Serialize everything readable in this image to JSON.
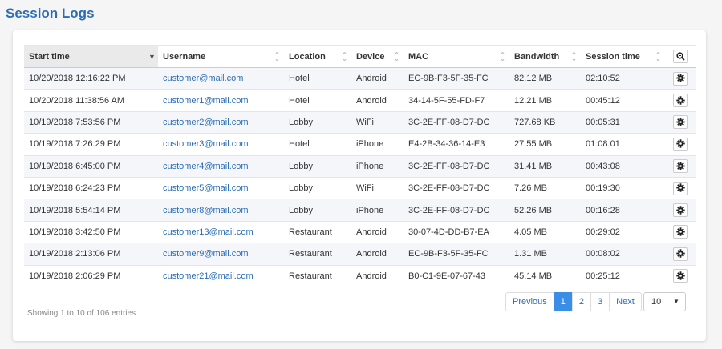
{
  "page": {
    "title": "Session Logs"
  },
  "table": {
    "columns": [
      "Start time",
      "Username",
      "Location",
      "Device",
      "MAC",
      "Bandwidth",
      "Session time"
    ],
    "sorted_column": "Start time",
    "rows": [
      [
        "10/20/2018 12:16:22 PM",
        "customer@mail.com",
        "Hotel",
        "Android",
        "EC-9B-F3-5F-35-FC",
        "82.12 MB",
        "02:10:52"
      ],
      [
        "10/20/2018 11:38:56 AM",
        "customer1@mail.com",
        "Hotel",
        "Android",
        "34-14-5F-55-FD-F7",
        "12.21 MB",
        "00:45:12"
      ],
      [
        "10/19/2018 7:53:56 PM",
        "customer2@mail.com",
        "Lobby",
        "WiFi",
        "3C-2E-FF-08-D7-DC",
        "727.68 KB",
        "00:05:31"
      ],
      [
        "10/19/2018 7:26:29 PM",
        "customer3@mail.com",
        "Hotel",
        "iPhone",
        "E4-2B-34-36-14-E3",
        "27.55 MB",
        "01:08:01"
      ],
      [
        "10/19/2018 6:45:00 PM",
        "customer4@mail.com",
        "Lobby",
        "iPhone",
        "3C-2E-FF-08-D7-DC",
        "31.41 MB",
        "00:43:08"
      ],
      [
        "10/19/2018 6:24:23 PM",
        "customer5@mail.com",
        "Lobby",
        "WiFi",
        "3C-2E-FF-08-D7-DC",
        "7.26 MB",
        "00:19:30"
      ],
      [
        "10/19/2018 5:54:14 PM",
        "customer8@mail.com",
        "Lobby",
        "iPhone",
        "3C-2E-FF-08-D7-DC",
        "52.26 MB",
        "00:16:28"
      ],
      [
        "10/19/2018 3:42:50 PM",
        "customer13@mail.com",
        "Restaurant",
        "Android",
        "30-07-4D-DD-B7-EA",
        "4.05 MB",
        "00:29:02"
      ],
      [
        "10/19/2018 2:13:06 PM",
        "customer9@mail.com",
        "Restaurant",
        "Android",
        "EC-9B-F3-5F-35-FC",
        "1.31 MB",
        "00:08:02"
      ],
      [
        "10/19/2018 2:06:29 PM",
        "customer21@mail.com",
        "Restaurant",
        "Android",
        "B0-C1-9E-07-67-43",
        "45.14 MB",
        "00:25:12"
      ]
    ],
    "header_action_icon": "search-zoom-icon",
    "row_action_icon": "gear-icon"
  },
  "footer": {
    "info": "Showing 1 to 10 of 106 entries",
    "pagination": {
      "previous": "Previous",
      "pages": [
        "1",
        "2",
        "3"
      ],
      "active_page": "1",
      "next": "Next"
    },
    "page_size": "10"
  },
  "colors": {
    "accent": "#2a6db5",
    "active_page": "#3a8ee6",
    "row_stripe": "#f4f6fa"
  }
}
